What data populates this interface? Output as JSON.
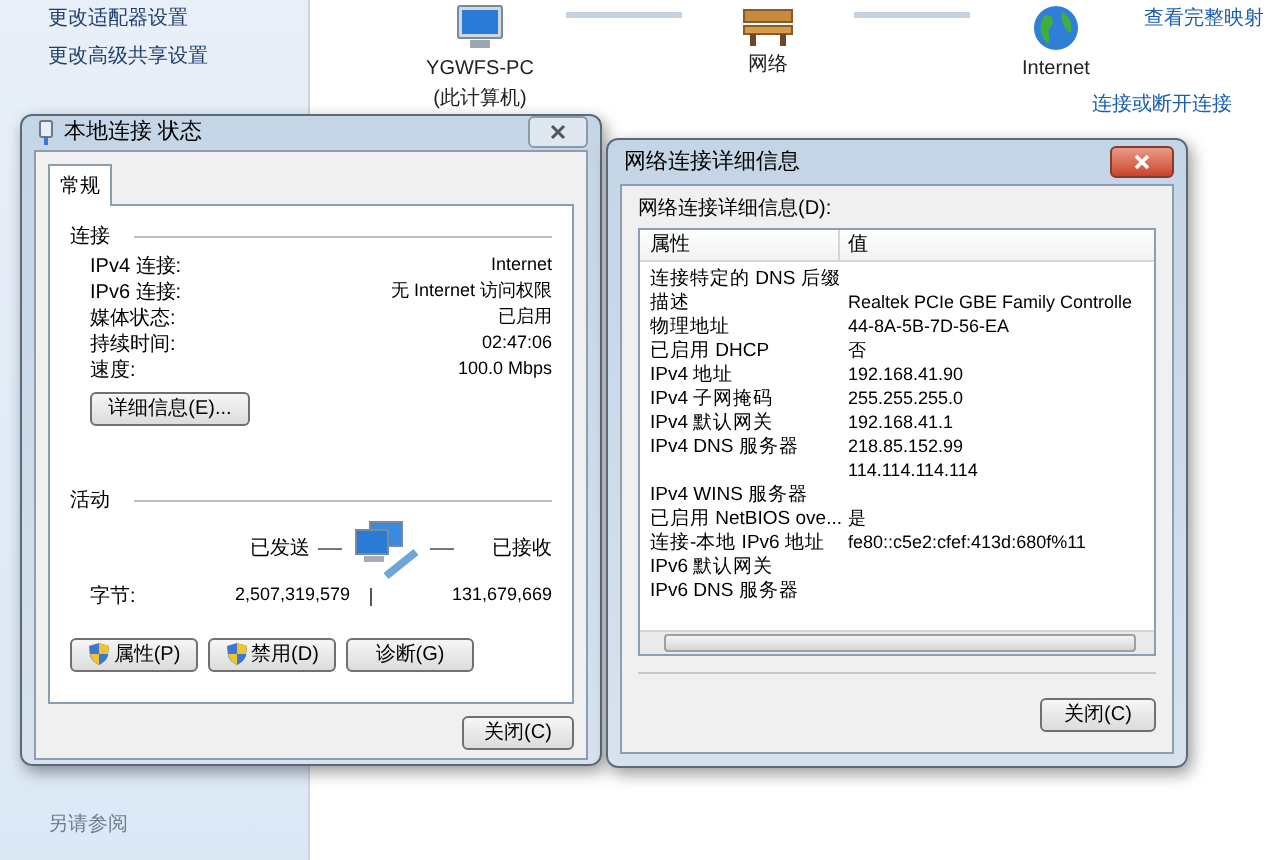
{
  "background": {
    "sidebar_links": [
      "更改适配器设置",
      "更改高级共享设置"
    ],
    "see_also": "另请参阅",
    "network_map": [
      {
        "kind": "computer",
        "label": "YGWFS-PC",
        "sublabel": "(此计算机)"
      },
      {
        "kind": "bench",
        "label": "网络"
      },
      {
        "kind": "globe",
        "label": "Internet"
      }
    ],
    "map_links": [
      "查看完整映射",
      "连接或断开连接"
    ]
  },
  "status_dialog": {
    "title": "本地连接 状态",
    "tabs": [
      {
        "label": "常规",
        "selected": true
      }
    ],
    "connection_heading": "连接",
    "rows": [
      {
        "label": "IPv4 连接:",
        "value": "Internet"
      },
      {
        "label": "IPv6 连接:",
        "value": "无 Internet 访问权限"
      },
      {
        "label": "媒体状态:",
        "value": "已启用"
      },
      {
        "label": "持续时间:",
        "value": "02:47:06"
      },
      {
        "label": "速度:",
        "value": "100.0 Mbps"
      }
    ],
    "details_button": "详细信息(E)...",
    "activity_heading": "活动",
    "sent_label": "已发送",
    "received_label": "已接收",
    "bytes_label": "字节:",
    "sent_value": "2,507,319,579",
    "received_value": "131,679,669",
    "buttons": [
      {
        "label": "属性(P)",
        "shield": true
      },
      {
        "label": "禁用(D)",
        "shield": true
      },
      {
        "label": "诊断(G)",
        "shield": false
      }
    ],
    "close_button": "关闭(C)"
  },
  "details_dialog": {
    "title": "网络连接详细信息",
    "list_label": "网络连接详细信息(D):",
    "columns": [
      "属性",
      "值"
    ],
    "rows": [
      {
        "property": "连接特定的 DNS 后缀",
        "value": ""
      },
      {
        "property": "描述",
        "value": "Realtek PCIe GBE Family Controlle"
      },
      {
        "property": "物理地址",
        "value": "44-8A-5B-7D-56-EA"
      },
      {
        "property": "已启用 DHCP",
        "value": "否"
      },
      {
        "property": "IPv4 地址",
        "value": "192.168.41.90"
      },
      {
        "property": "IPv4 子网掩码",
        "value": "255.255.255.0"
      },
      {
        "property": "IPv4 默认网关",
        "value": "192.168.41.1"
      },
      {
        "property": "IPv4 DNS 服务器",
        "value": "218.85.152.99"
      },
      {
        "property": "",
        "value": "114.114.114.114"
      },
      {
        "property": "IPv4 WINS 服务器",
        "value": ""
      },
      {
        "property": "已启用 NetBIOS ove...",
        "value": "是"
      },
      {
        "property": "连接-本地 IPv6 地址",
        "value": "fe80::c5e2:cfef:413d:680f%11"
      },
      {
        "property": "IPv6 默认网关",
        "value": ""
      },
      {
        "property": "IPv6 DNS 服务器",
        "value": ""
      }
    ],
    "close_button": "关闭(C)"
  }
}
